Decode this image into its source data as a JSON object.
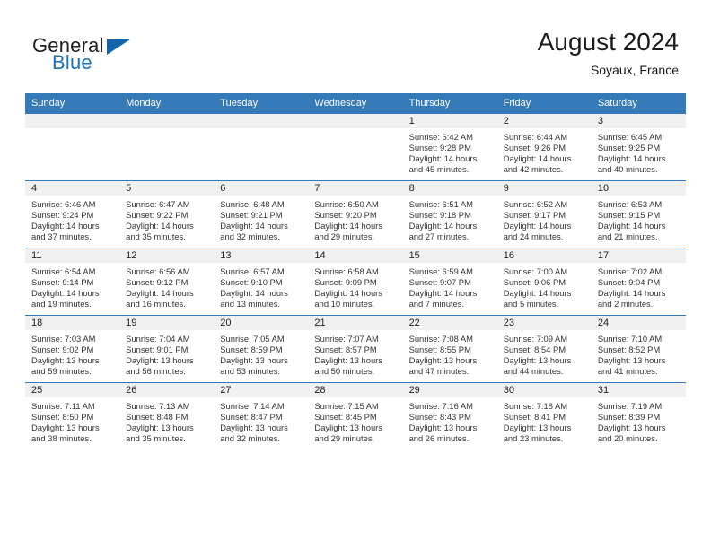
{
  "brand": {
    "word_one": "General",
    "word_two": "Blue",
    "logo_icon": "triangle-logo-icon",
    "accent_color": "#1264ab",
    "blue_text_color": "#1e73be"
  },
  "header": {
    "title": "August 2024",
    "subtitle": "Soyaux, France"
  },
  "calendar": {
    "header_bg": "#3479b8",
    "header_text_color": "#ffffff",
    "daynum_band_bg": "#f0f0f0",
    "weekday_headers": [
      "Sunday",
      "Monday",
      "Tuesday",
      "Wednesday",
      "Thursday",
      "Friday",
      "Saturday"
    ],
    "weeks": [
      [
        {
          "day": "",
          "empty": true
        },
        {
          "day": "",
          "empty": true
        },
        {
          "day": "",
          "empty": true
        },
        {
          "day": "",
          "empty": true
        },
        {
          "day": "1",
          "sunrise": "Sunrise: 6:42 AM",
          "sunset": "Sunset: 9:28 PM",
          "daylight_line1": "Daylight: 14 hours",
          "daylight_line2": "and 45 minutes."
        },
        {
          "day": "2",
          "sunrise": "Sunrise: 6:44 AM",
          "sunset": "Sunset: 9:26 PM",
          "daylight_line1": "Daylight: 14 hours",
          "daylight_line2": "and 42 minutes."
        },
        {
          "day": "3",
          "sunrise": "Sunrise: 6:45 AM",
          "sunset": "Sunset: 9:25 PM",
          "daylight_line1": "Daylight: 14 hours",
          "daylight_line2": "and 40 minutes."
        }
      ],
      [
        {
          "day": "4",
          "sunrise": "Sunrise: 6:46 AM",
          "sunset": "Sunset: 9:24 PM",
          "daylight_line1": "Daylight: 14 hours",
          "daylight_line2": "and 37 minutes."
        },
        {
          "day": "5",
          "sunrise": "Sunrise: 6:47 AM",
          "sunset": "Sunset: 9:22 PM",
          "daylight_line1": "Daylight: 14 hours",
          "daylight_line2": "and 35 minutes."
        },
        {
          "day": "6",
          "sunrise": "Sunrise: 6:48 AM",
          "sunset": "Sunset: 9:21 PM",
          "daylight_line1": "Daylight: 14 hours",
          "daylight_line2": "and 32 minutes."
        },
        {
          "day": "7",
          "sunrise": "Sunrise: 6:50 AM",
          "sunset": "Sunset: 9:20 PM",
          "daylight_line1": "Daylight: 14 hours",
          "daylight_line2": "and 29 minutes."
        },
        {
          "day": "8",
          "sunrise": "Sunrise: 6:51 AM",
          "sunset": "Sunset: 9:18 PM",
          "daylight_line1": "Daylight: 14 hours",
          "daylight_line2": "and 27 minutes."
        },
        {
          "day": "9",
          "sunrise": "Sunrise: 6:52 AM",
          "sunset": "Sunset: 9:17 PM",
          "daylight_line1": "Daylight: 14 hours",
          "daylight_line2": "and 24 minutes."
        },
        {
          "day": "10",
          "sunrise": "Sunrise: 6:53 AM",
          "sunset": "Sunset: 9:15 PM",
          "daylight_line1": "Daylight: 14 hours",
          "daylight_line2": "and 21 minutes."
        }
      ],
      [
        {
          "day": "11",
          "sunrise": "Sunrise: 6:54 AM",
          "sunset": "Sunset: 9:14 PM",
          "daylight_line1": "Daylight: 14 hours",
          "daylight_line2": "and 19 minutes."
        },
        {
          "day": "12",
          "sunrise": "Sunrise: 6:56 AM",
          "sunset": "Sunset: 9:12 PM",
          "daylight_line1": "Daylight: 14 hours",
          "daylight_line2": "and 16 minutes."
        },
        {
          "day": "13",
          "sunrise": "Sunrise: 6:57 AM",
          "sunset": "Sunset: 9:10 PM",
          "daylight_line1": "Daylight: 14 hours",
          "daylight_line2": "and 13 minutes."
        },
        {
          "day": "14",
          "sunrise": "Sunrise: 6:58 AM",
          "sunset": "Sunset: 9:09 PM",
          "daylight_line1": "Daylight: 14 hours",
          "daylight_line2": "and 10 minutes."
        },
        {
          "day": "15",
          "sunrise": "Sunrise: 6:59 AM",
          "sunset": "Sunset: 9:07 PM",
          "daylight_line1": "Daylight: 14 hours",
          "daylight_line2": "and 7 minutes."
        },
        {
          "day": "16",
          "sunrise": "Sunrise: 7:00 AM",
          "sunset": "Sunset: 9:06 PM",
          "daylight_line1": "Daylight: 14 hours",
          "daylight_line2": "and 5 minutes."
        },
        {
          "day": "17",
          "sunrise": "Sunrise: 7:02 AM",
          "sunset": "Sunset: 9:04 PM",
          "daylight_line1": "Daylight: 14 hours",
          "daylight_line2": "and 2 minutes."
        }
      ],
      [
        {
          "day": "18",
          "sunrise": "Sunrise: 7:03 AM",
          "sunset": "Sunset: 9:02 PM",
          "daylight_line1": "Daylight: 13 hours",
          "daylight_line2": "and 59 minutes."
        },
        {
          "day": "19",
          "sunrise": "Sunrise: 7:04 AM",
          "sunset": "Sunset: 9:01 PM",
          "daylight_line1": "Daylight: 13 hours",
          "daylight_line2": "and 56 minutes."
        },
        {
          "day": "20",
          "sunrise": "Sunrise: 7:05 AM",
          "sunset": "Sunset: 8:59 PM",
          "daylight_line1": "Daylight: 13 hours",
          "daylight_line2": "and 53 minutes."
        },
        {
          "day": "21",
          "sunrise": "Sunrise: 7:07 AM",
          "sunset": "Sunset: 8:57 PM",
          "daylight_line1": "Daylight: 13 hours",
          "daylight_line2": "and 50 minutes."
        },
        {
          "day": "22",
          "sunrise": "Sunrise: 7:08 AM",
          "sunset": "Sunset: 8:55 PM",
          "daylight_line1": "Daylight: 13 hours",
          "daylight_line2": "and 47 minutes."
        },
        {
          "day": "23",
          "sunrise": "Sunrise: 7:09 AM",
          "sunset": "Sunset: 8:54 PM",
          "daylight_line1": "Daylight: 13 hours",
          "daylight_line2": "and 44 minutes."
        },
        {
          "day": "24",
          "sunrise": "Sunrise: 7:10 AM",
          "sunset": "Sunset: 8:52 PM",
          "daylight_line1": "Daylight: 13 hours",
          "daylight_line2": "and 41 minutes."
        }
      ],
      [
        {
          "day": "25",
          "sunrise": "Sunrise: 7:11 AM",
          "sunset": "Sunset: 8:50 PM",
          "daylight_line1": "Daylight: 13 hours",
          "daylight_line2": "and 38 minutes."
        },
        {
          "day": "26",
          "sunrise": "Sunrise: 7:13 AM",
          "sunset": "Sunset: 8:48 PM",
          "daylight_line1": "Daylight: 13 hours",
          "daylight_line2": "and 35 minutes."
        },
        {
          "day": "27",
          "sunrise": "Sunrise: 7:14 AM",
          "sunset": "Sunset: 8:47 PM",
          "daylight_line1": "Daylight: 13 hours",
          "daylight_line2": "and 32 minutes."
        },
        {
          "day": "28",
          "sunrise": "Sunrise: 7:15 AM",
          "sunset": "Sunset: 8:45 PM",
          "daylight_line1": "Daylight: 13 hours",
          "daylight_line2": "and 29 minutes."
        },
        {
          "day": "29",
          "sunrise": "Sunrise: 7:16 AM",
          "sunset": "Sunset: 8:43 PM",
          "daylight_line1": "Daylight: 13 hours",
          "daylight_line2": "and 26 minutes."
        },
        {
          "day": "30",
          "sunrise": "Sunrise: 7:18 AM",
          "sunset": "Sunset: 8:41 PM",
          "daylight_line1": "Daylight: 13 hours",
          "daylight_line2": "and 23 minutes."
        },
        {
          "day": "31",
          "sunrise": "Sunrise: 7:19 AM",
          "sunset": "Sunset: 8:39 PM",
          "daylight_line1": "Daylight: 13 hours",
          "daylight_line2": "and 20 minutes."
        }
      ]
    ]
  }
}
